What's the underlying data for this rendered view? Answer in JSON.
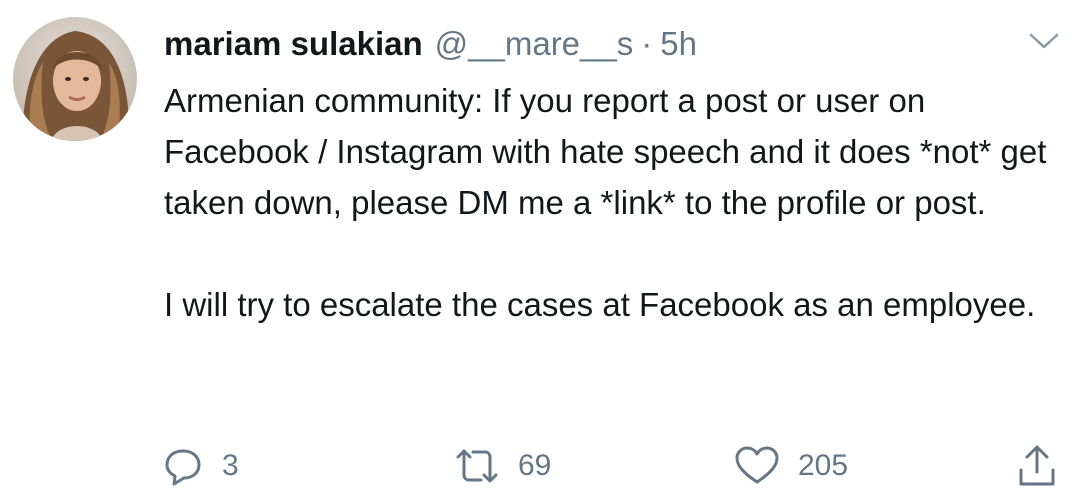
{
  "tweet": {
    "display_name": "mariam sulakian",
    "handle": "@__mare__s",
    "separator": "·",
    "timestamp": "5h",
    "paragraphs": [
      "Armenian community: If you report a post or user on Facebook / Instagram with hate speech and it does *not* get taken down, please DM me a *link* to the profile or post.",
      "I will try to escalate the cases at Facebook as an employee."
    ],
    "actions": {
      "reply_count": "3",
      "retweet_count": "69",
      "like_count": "205"
    }
  },
  "icons": {
    "menu": "chevron-down-icon",
    "reply": "reply-icon",
    "retweet": "retweet-icon",
    "like": "heart-icon",
    "share": "share-icon"
  },
  "colors": {
    "text_primary": "#14171a",
    "text_secondary": "#657786"
  }
}
